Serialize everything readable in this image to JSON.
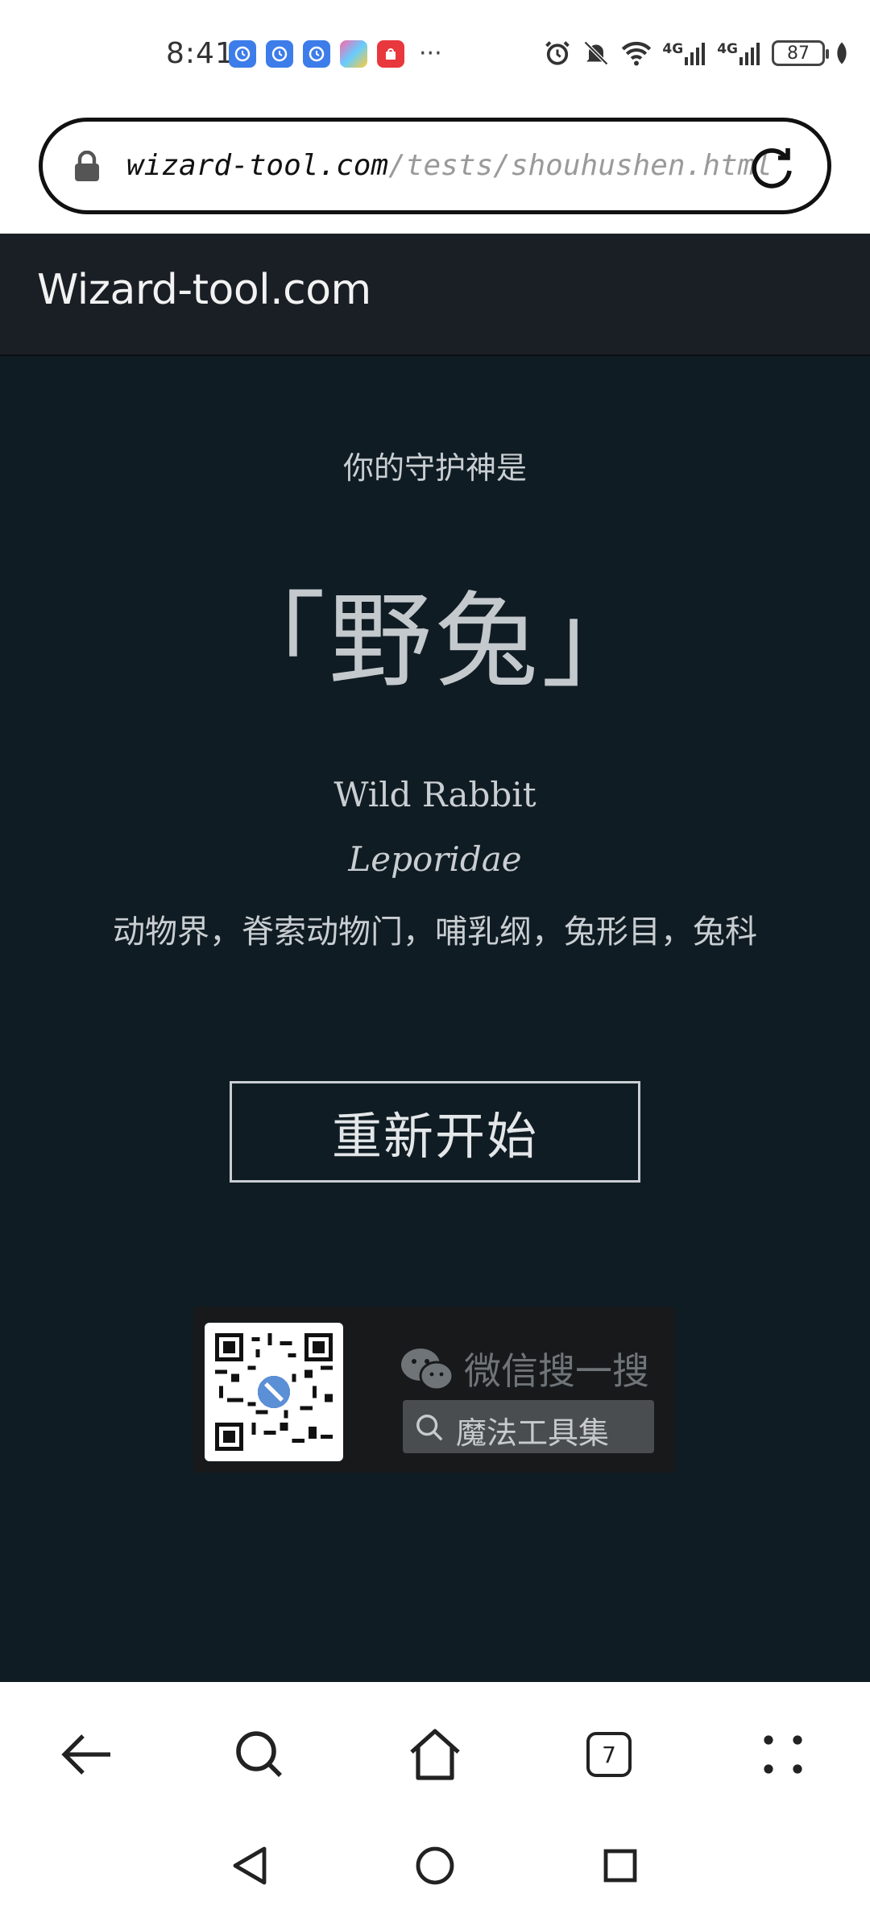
{
  "status_bar": {
    "time": "8:41",
    "more_indicator": "···",
    "signal_label_1": "4G",
    "signal_label_2": "4G",
    "battery": "87"
  },
  "address_bar": {
    "domain": "wizard-tool.com",
    "path": "/tests/shouhushen.html"
  },
  "site": {
    "logo": "Wizard-tool.com"
  },
  "result": {
    "subtitle": "你的守护神是",
    "name": "「野兔」",
    "english": "Wild Rabbit",
    "latin": "Leporidae",
    "taxonomy": "动物界，脊索动物门，哺乳纲，兔形目，兔科",
    "restart_label": "重新开始"
  },
  "wechat": {
    "search_prompt": "微信搜一搜",
    "account_name": "魔法工具集"
  },
  "browser_nav": {
    "tab_count": "7"
  },
  "colors": {
    "content_bg": "#101c23",
    "header_bg": "#1a1f25",
    "text_light": "#c9ced2"
  }
}
